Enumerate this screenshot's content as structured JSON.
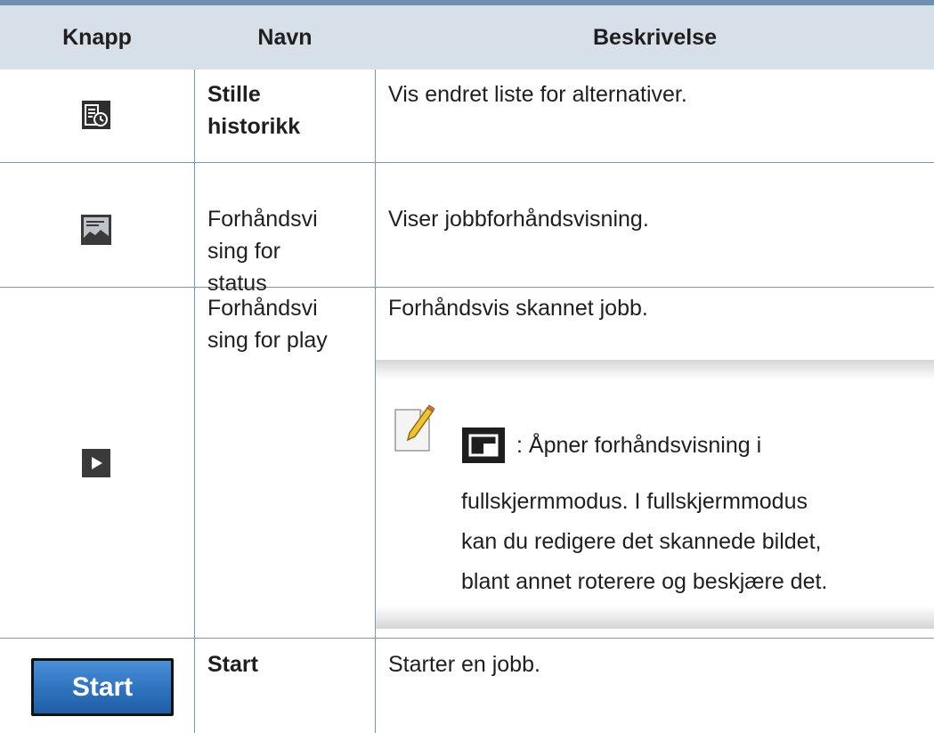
{
  "table": {
    "headers": [
      "Knapp",
      "Navn",
      "Beskrivelse"
    ],
    "rows": [
      {
        "icon": "history-list-icon",
        "name_lines": [
          "Stille",
          "historikk"
        ],
        "name_bold": true,
        "description": "Vis endret liste for alternativer."
      },
      {
        "icon": "image-preview-icon",
        "name_lines": [
          "Forhåndsvi",
          "sing for",
          "status"
        ],
        "name_bold": false,
        "description": "Viser jobbforhåndsvisning."
      },
      {
        "icon": "play-preview-icon",
        "name_lines": [
          "Forhåndsvi",
          "sing for play"
        ],
        "name_bold": false,
        "description": "Forhåndsvis skannet jobb.",
        "note": {
          "icon": "note-pencil-icon",
          "inline_icon": "fullscreen-icon",
          "first_line": ": Åpner forhåndsvisning i",
          "lines": [
            "fullskjermmodus. I fullskjermmodus",
            "kan du redigere det skannede bildet,",
            "blant annet roterere og beskjære det."
          ]
        }
      },
      {
        "icon": "start-button",
        "button_label": "Start",
        "name_lines": [
          "Start"
        ],
        "name_bold": true,
        "description": "Starter en jobb."
      }
    ]
  },
  "colors": {
    "header_bg": "#d7dfe9",
    "rule": "#7a96bb",
    "top_rule": "#6f8fb1",
    "start_button": "#2e72bd"
  }
}
